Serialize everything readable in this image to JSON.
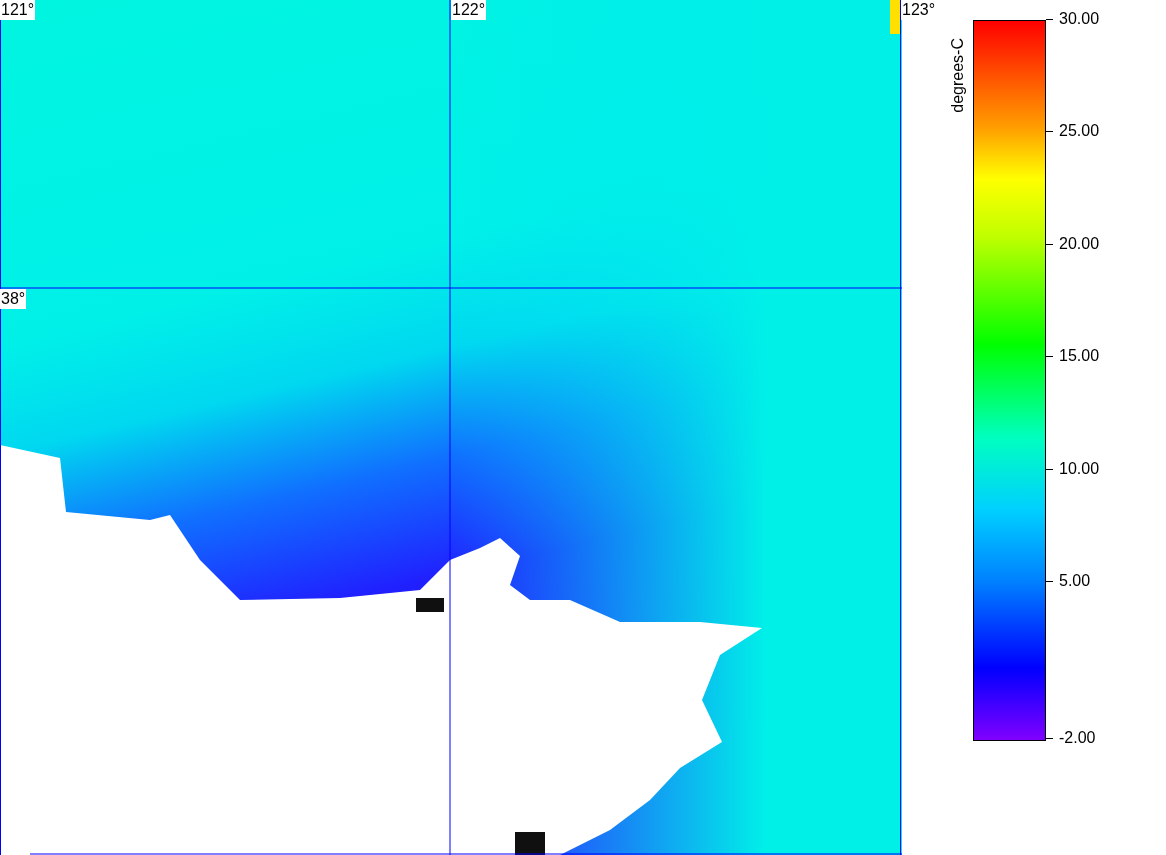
{
  "map": {
    "grid_labels": [
      "121°",
      "122°",
      "123°",
      "38°"
    ]
  },
  "legend": {
    "unit": "degrees-C",
    "ticks": [
      "30.00",
      "25.00",
      "20.00",
      "15.00",
      "10.00",
      "5.00",
      "-2.00"
    ]
  }
}
